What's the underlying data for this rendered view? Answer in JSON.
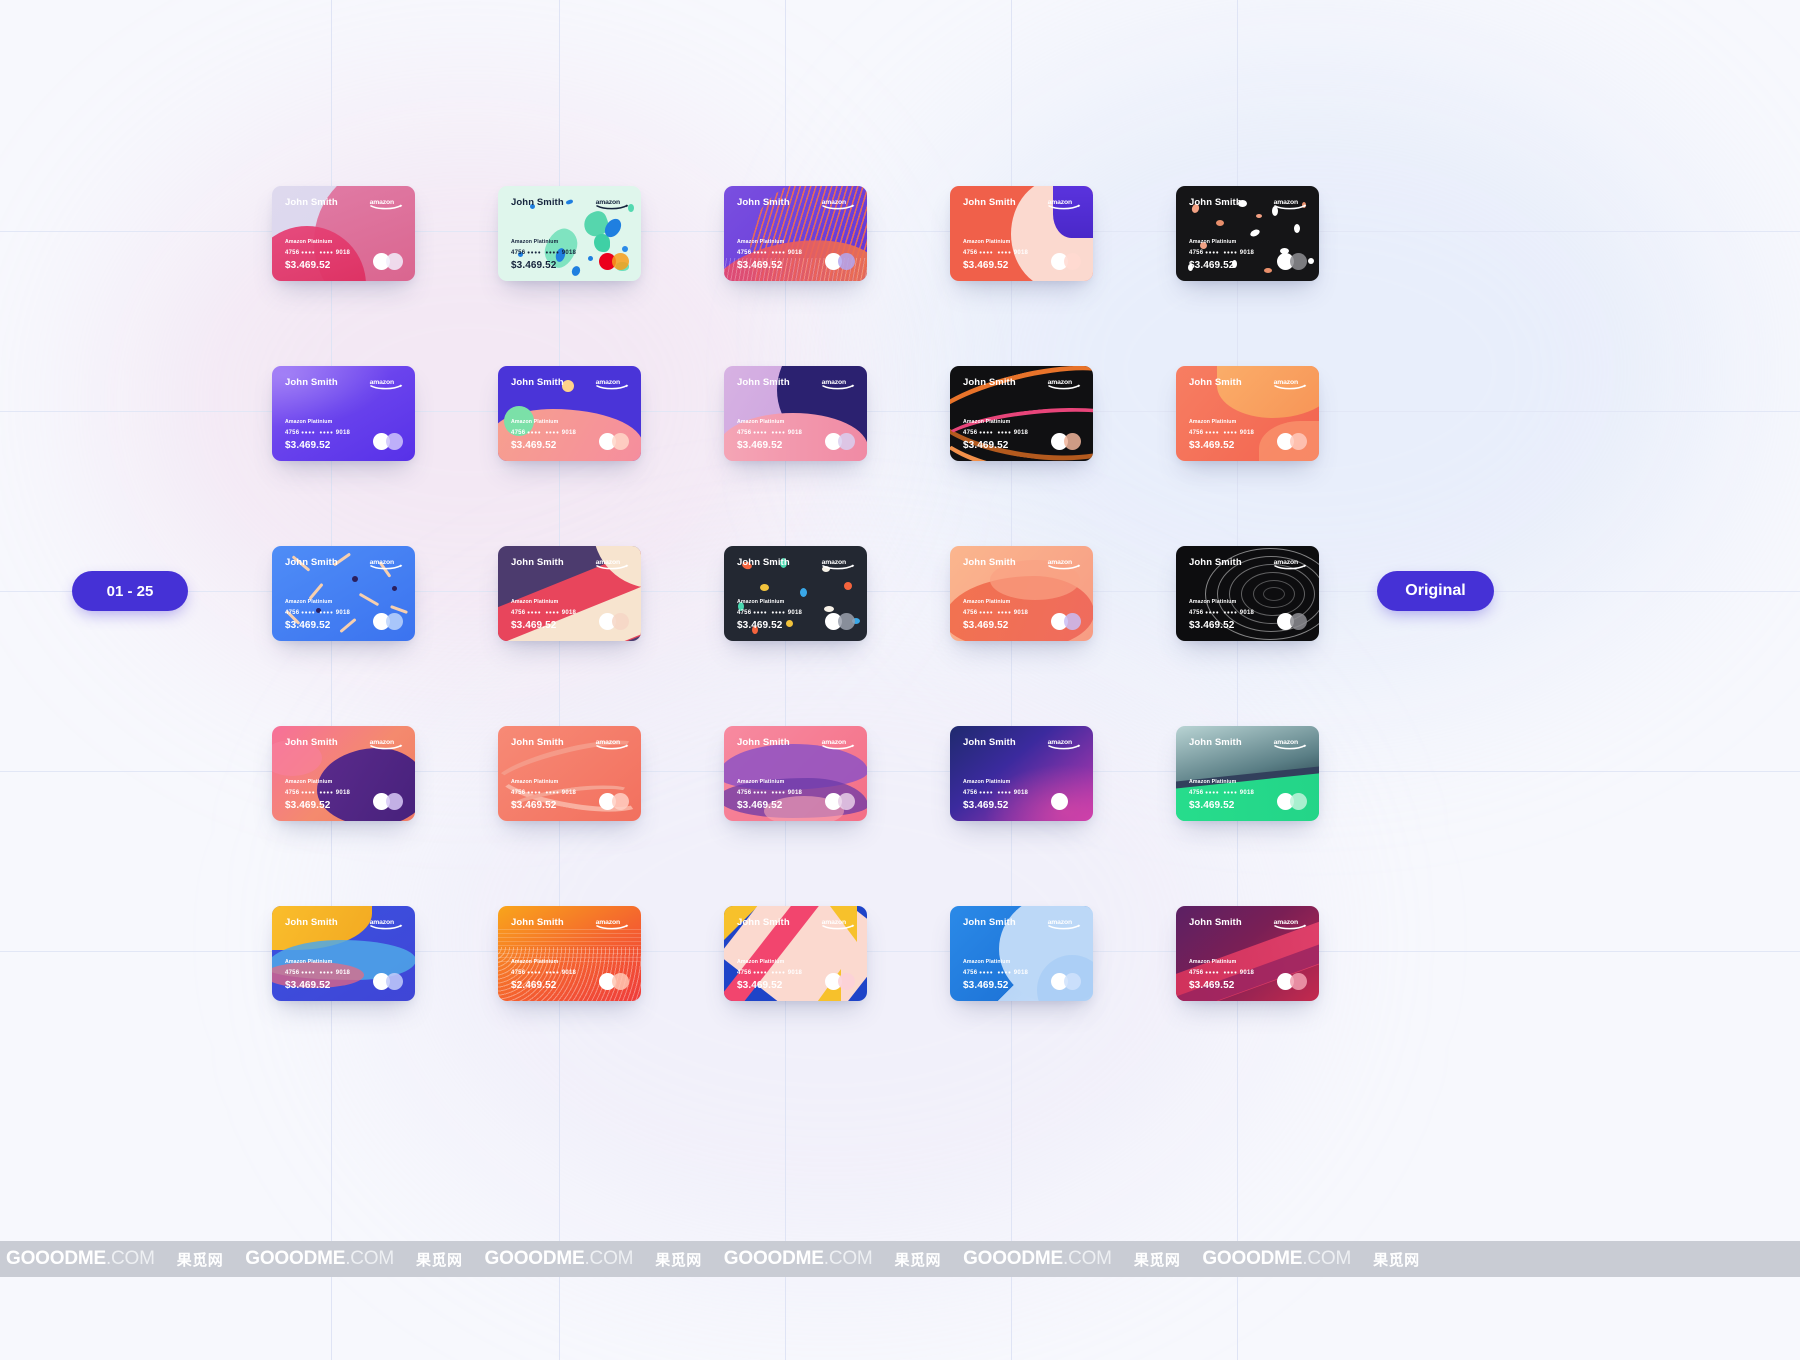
{
  "page": {
    "background": "#f7f8fd",
    "watermark_band_color": "#c9ccd4"
  },
  "left_badge": {
    "label": "01 - 25",
    "color": "#4531d6"
  },
  "right_badge": {
    "label": "Original",
    "color": "#4531d6"
  },
  "card_defaults": {
    "holder": "John Smith",
    "tier": "Amazon Platinium",
    "num_first": "4756",
    "num_mid1": "••••",
    "num_mid2": "••••",
    "num_last": "9018",
    "amount": "$3.469.52",
    "brand_logo": "amazon-wordmark",
    "network_logo": "mastercard-icon"
  },
  "cards": [
    {
      "id": "card-01",
      "row": 1,
      "col": 1,
      "name": "blush-circles",
      "style": "c1",
      "text": "#ffffff",
      "amount": "$3.469.52"
    },
    {
      "id": "card-02",
      "row": 1,
      "col": 2,
      "name": "mint-terrazzo",
      "style": "c2",
      "text": "#17223b",
      "amount": "$3.469.52"
    },
    {
      "id": "card-03",
      "row": 1,
      "col": 3,
      "name": "purple-wave-lines",
      "style": "c3",
      "text": "#ffffff",
      "amount": "$3.469.52"
    },
    {
      "id": "card-04",
      "row": 1,
      "col": 4,
      "name": "coral-arc-violet",
      "style": "c4",
      "text": "#ffffff",
      "amount": "$3.469.52"
    },
    {
      "id": "card-05",
      "row": 1,
      "col": 5,
      "name": "black-terrazzo",
      "style": "c5",
      "text": "#ffffff",
      "amount": "$3.469.52"
    },
    {
      "id": "card-06",
      "row": 2,
      "col": 1,
      "name": "violet-soft-gradient",
      "style": "c6",
      "text": "#ffffff",
      "amount": "$3.469.52"
    },
    {
      "id": "card-07",
      "row": 2,
      "col": 2,
      "name": "indigo-peach-blocks",
      "style": "c7",
      "text": "#ffffff",
      "amount": "$3.469.52"
    },
    {
      "id": "card-08",
      "row": 2,
      "col": 3,
      "name": "lilac-navy-curve",
      "style": "c8",
      "text": "#ffffff",
      "amount": "$3.469.52"
    },
    {
      "id": "card-09",
      "row": 2,
      "col": 4,
      "name": "black-orange-ribbons",
      "style": "c9",
      "text": "#ffffff",
      "amount": "$3.469.52"
    },
    {
      "id": "card-10",
      "row": 2,
      "col": 5,
      "name": "coral-orange-blob",
      "style": "c10",
      "text": "#ffffff",
      "amount": "$3.469.52"
    },
    {
      "id": "card-11",
      "row": 3,
      "col": 1,
      "name": "blue-confetti-sticks",
      "style": "c11",
      "text": "#ffffff",
      "amount": "$3.469.52"
    },
    {
      "id": "card-12",
      "row": 3,
      "col": 2,
      "name": "plum-red-cream-diagonal",
      "style": "c12",
      "text": "#ffffff",
      "amount": "$3.469.52"
    },
    {
      "id": "card-13",
      "row": 3,
      "col": 3,
      "name": "charcoal-confetti",
      "style": "c13",
      "text": "#ffffff",
      "amount": "$3.469.52"
    },
    {
      "id": "card-14",
      "row": 3,
      "col": 4,
      "name": "peach-wave-blob",
      "style": "c14",
      "text": "#ffffff",
      "amount": "$3.469.52"
    },
    {
      "id": "card-15",
      "row": 3,
      "col": 5,
      "name": "black-concentric-rings",
      "style": "c15",
      "text": "#ffffff",
      "amount": "$3.469.52"
    },
    {
      "id": "card-16",
      "row": 4,
      "col": 1,
      "name": "pink-orange-purple-blob",
      "style": "c16",
      "text": "#ffffff",
      "amount": "$3.469.52"
    },
    {
      "id": "card-17",
      "row": 4,
      "col": 2,
      "name": "salmon-ribbon",
      "style": "c17",
      "text": "#ffffff",
      "amount": "$3.469.52"
    },
    {
      "id": "card-18",
      "row": 4,
      "col": 3,
      "name": "rose-purple-waves",
      "style": "c18",
      "text": "#ffffff",
      "amount": "$3.469.52"
    },
    {
      "id": "card-19",
      "row": 4,
      "col": 4,
      "name": "navy-magenta-gradient",
      "style": "c19",
      "text": "#ffffff",
      "amount": "$3.469.52"
    },
    {
      "id": "card-20",
      "row": 4,
      "col": 5,
      "name": "slate-mint-stripes",
      "style": "c20",
      "text": "#ffffff",
      "amount": "$3.469.52"
    },
    {
      "id": "card-21",
      "row": 5,
      "col": 1,
      "name": "amber-blue-wave",
      "style": "c21",
      "text": "#ffffff",
      "amount": "$3.469.52"
    },
    {
      "id": "card-22",
      "row": 5,
      "col": 2,
      "name": "orange-red-halftone",
      "style": "c22",
      "text": "#ffffff",
      "amount": "$2.469.52"
    },
    {
      "id": "card-23",
      "row": 5,
      "col": 3,
      "name": "yellow-blue-pink-shards",
      "style": "c23",
      "text": "#ffffff",
      "amount": "$3.469.52"
    },
    {
      "id": "card-24",
      "row": 5,
      "col": 4,
      "name": "azure-bubble",
      "style": "c24",
      "text": "#ffffff",
      "amount": "$3.469.52"
    },
    {
      "id": "card-25",
      "row": 5,
      "col": 5,
      "name": "plum-crimson-diagonal",
      "style": "c25",
      "text": "#ffffff",
      "amount": "$3.469.52"
    }
  ],
  "watermark": {
    "site": "GOOODME",
    "tld": ".COM",
    "cn": "果觅网",
    "repeat": 6
  }
}
